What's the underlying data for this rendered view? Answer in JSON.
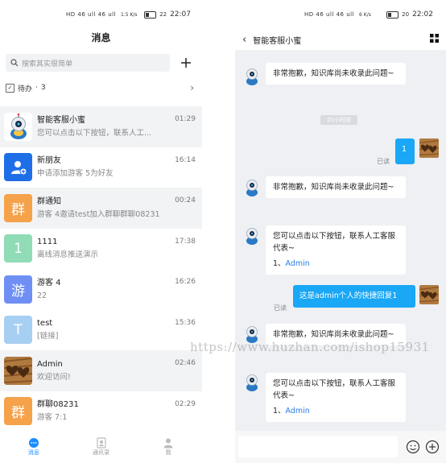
{
  "left": {
    "status": {
      "signal": "HD 46 ull 46 ull",
      "speed": "1.5 K/s",
      "battery": "22",
      "time": "22:07"
    },
    "title": "消息",
    "search_placeholder": "搜索其实很简单",
    "todo_label": "待办",
    "todo_count": "3",
    "conversations": [
      {
        "name": "智能客服小蜜",
        "preview": "您可以点击以下按钮，联系人工...",
        "time": "01:29",
        "avatar_text": "",
        "avatar_color": "#ffffff"
      },
      {
        "name": "新朋友",
        "preview": "申请添加游客 5为好友",
        "time": "16:14",
        "avatar_text": "",
        "avatar_color": "#1e6ee8"
      },
      {
        "name": "群通知",
        "preview": "游客 4邀请test加入群聊群聊08231",
        "time": "00:24",
        "avatar_text": "群",
        "avatar_color": "#f5a24b"
      },
      {
        "name": "1111",
        "preview": "离线消息推送演示",
        "time": "17:38",
        "avatar_text": "1",
        "avatar_color": "#8fdcb6"
      },
      {
        "name": "游客 4",
        "preview": "22",
        "time": "16:26",
        "avatar_text": "游",
        "avatar_color": "#6f8ff5"
      },
      {
        "name": "test",
        "preview": "[链接]",
        "time": "15:36",
        "avatar_text": "T",
        "avatar_color": "#a7cff2"
      },
      {
        "name": "Admin",
        "preview": "欢迎访问!",
        "time": "02:46",
        "avatar_text": "",
        "avatar_color": "#8a5a2b"
      },
      {
        "name": "群聊08231",
        "preview": "游客 7:1",
        "time": "02:29",
        "avatar_text": "群",
        "avatar_color": "#f5a24b"
      }
    ],
    "tabs": [
      {
        "label": "消息",
        "icon": "chat-bubble-icon"
      },
      {
        "label": "通讯录",
        "icon": "contacts-icon"
      },
      {
        "label": "我",
        "icon": "person-icon"
      }
    ]
  },
  "right": {
    "status": {
      "signal": "HD 46 ull 46 ull",
      "speed": "6 K/s",
      "battery": "20",
      "time": "22:02"
    },
    "title": "智能客服小蜜",
    "time_chip": "20小时前",
    "messages": [
      {
        "from": "bot",
        "text": "非常抱歉，知识库尚未收录此问题~"
      },
      {
        "from": "me",
        "text": "1",
        "status": "已读"
      },
      {
        "from": "bot",
        "text": "非常抱歉，知识库尚未收录此问题~"
      },
      {
        "from": "bot",
        "text": "您可以点击以下按钮，联系人工客服代表~",
        "option_prefix": "1、",
        "option_link": "Admin"
      },
      {
        "from": "me",
        "text": "这是admin个人的快捷回复1",
        "status": "已读"
      },
      {
        "from": "bot",
        "text": "非常抱歉，知识库尚未收录此问题~"
      },
      {
        "from": "bot",
        "text": "您可以点击以下按钮，联系人工客服代表~",
        "option_prefix": "1、",
        "option_link": "Admin"
      }
    ]
  },
  "watermark": "https://www.huzhan.com/ishop15931"
}
